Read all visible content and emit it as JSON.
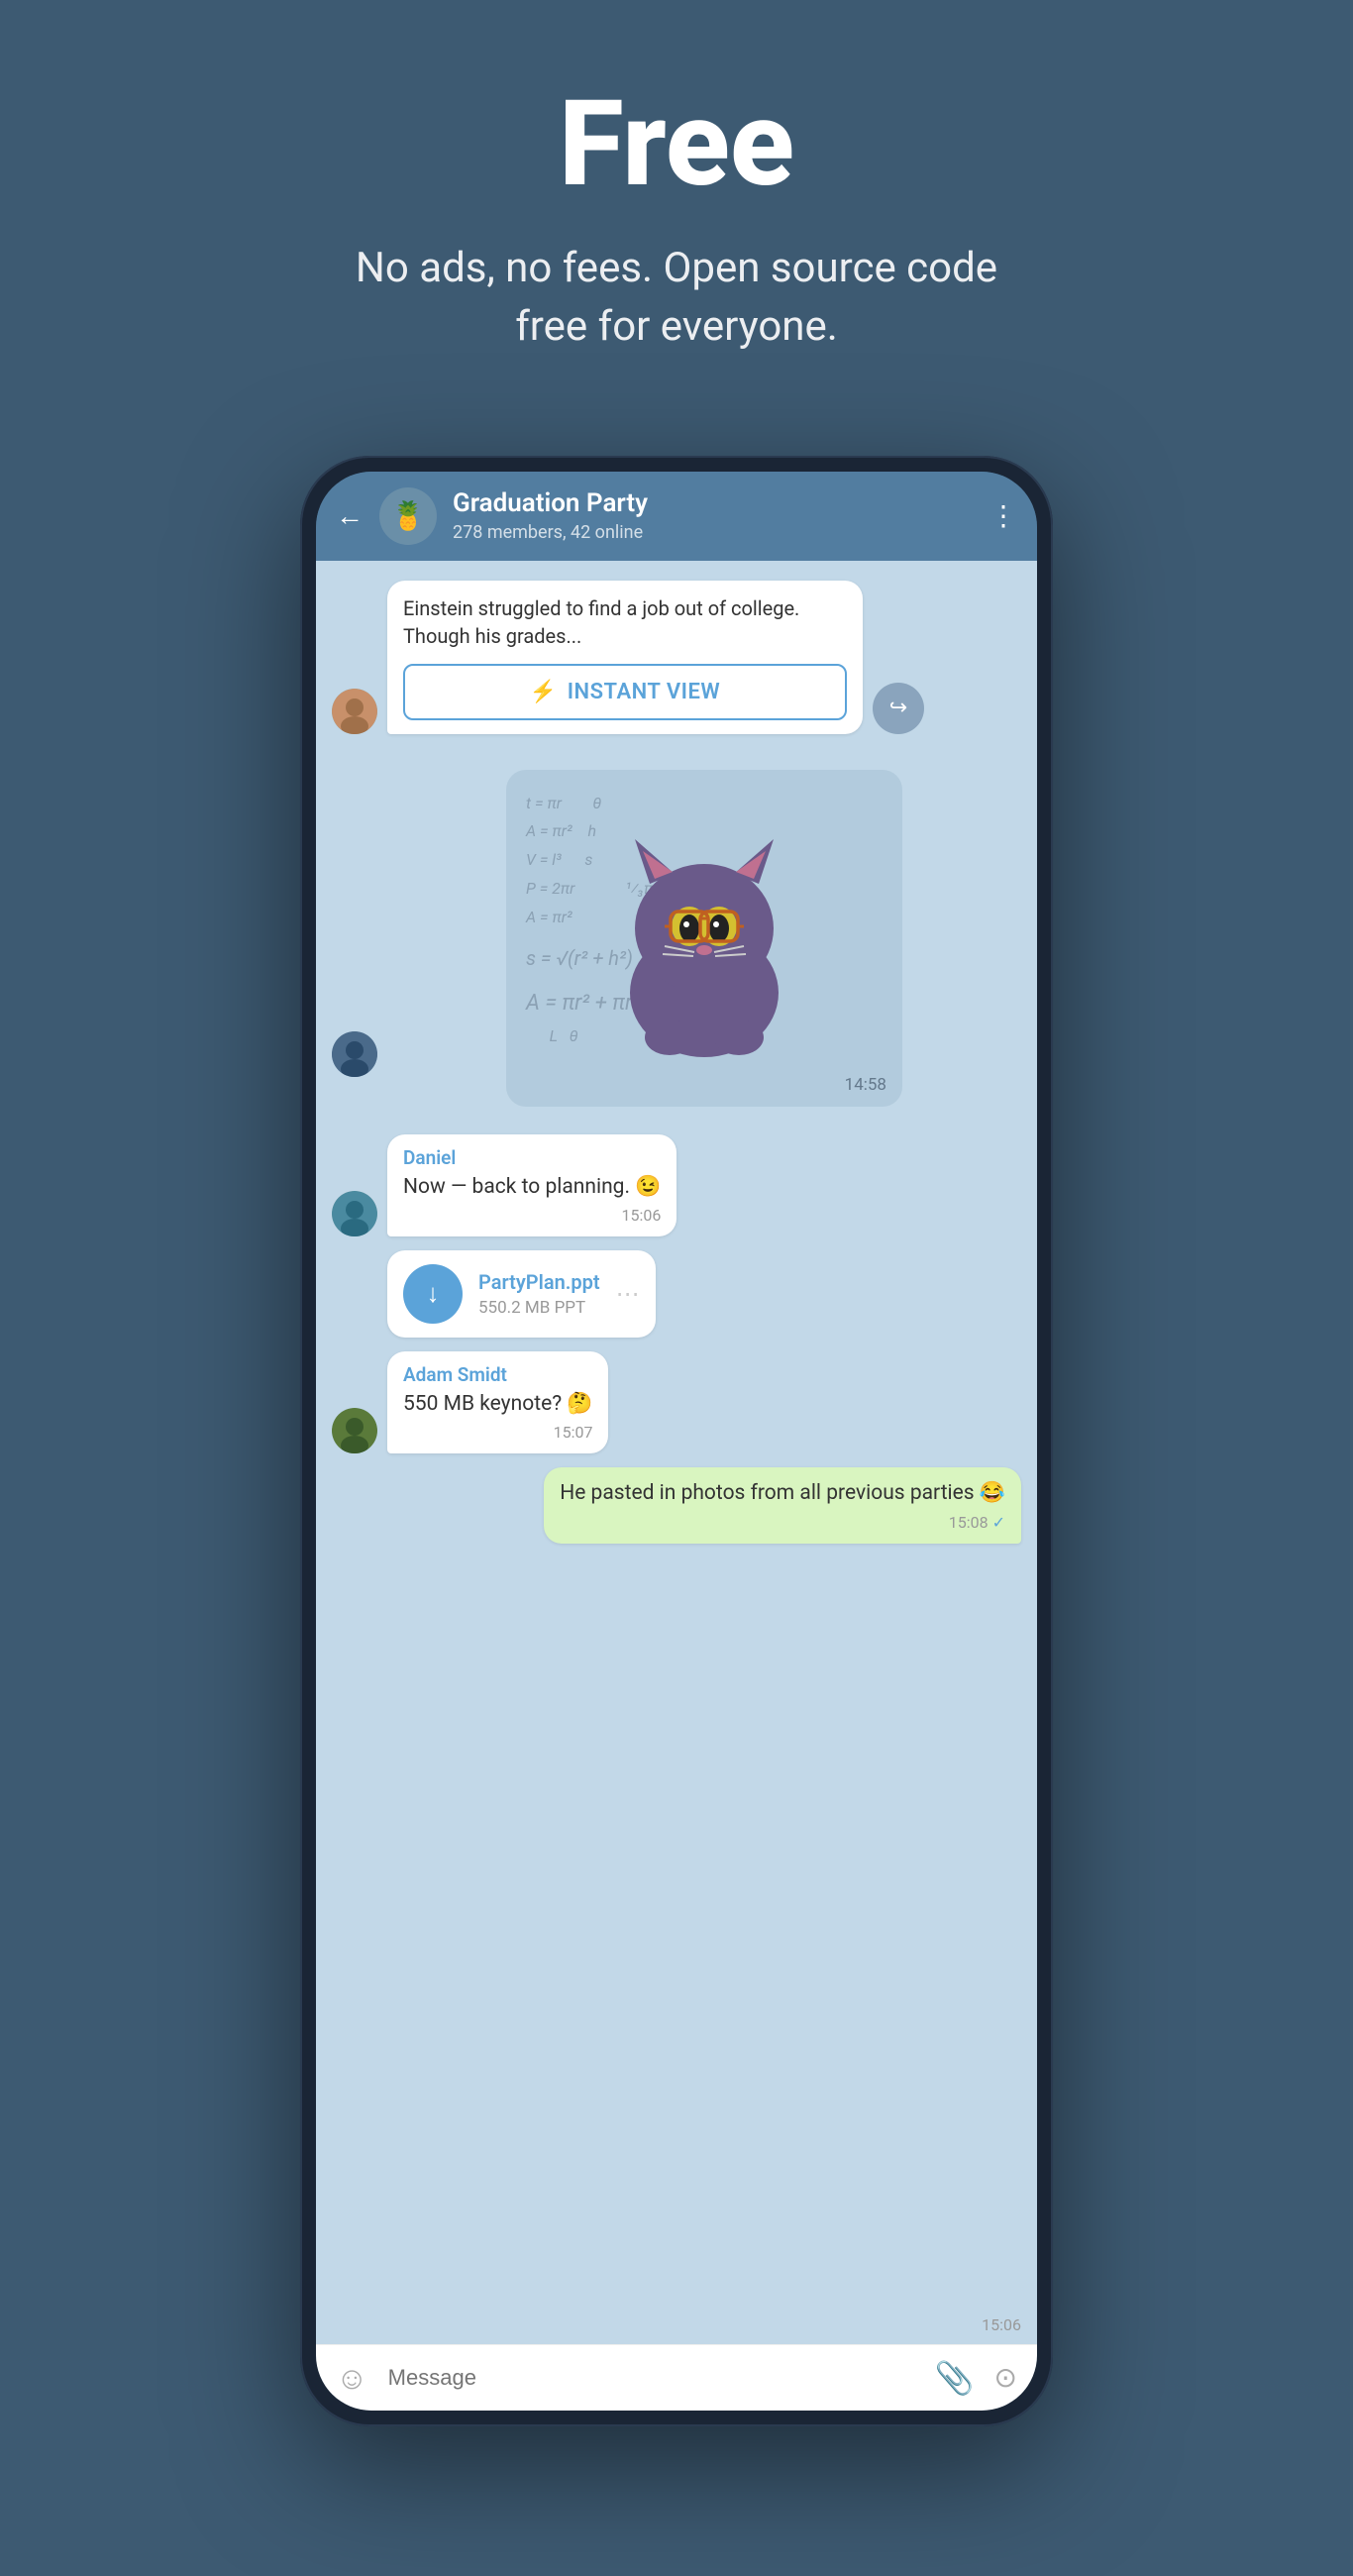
{
  "hero": {
    "title": "Free",
    "subtitle": "No ads, no fees. Open source code free for everyone."
  },
  "header": {
    "back_label": "←",
    "chat_name": "Graduation Party",
    "chat_meta": "278 members, 42 online",
    "more_icon": "⋮"
  },
  "messages": {
    "article": {
      "text": "Einstein struggled to find a job out of college. Though his grades...",
      "instant_view_label": "INSTANT VIEW"
    },
    "sticker_time": "14:58",
    "daniel": {
      "name": "Daniel",
      "text": "Now — back to planning. 😉",
      "time": "15:06"
    },
    "file": {
      "name": "PartyPlan.ppt",
      "size": "550.2 MB PPT",
      "time": "15:06"
    },
    "adam": {
      "name": "Adam Smidt",
      "text": "550 MB keynote? 🤔",
      "time": "15:07"
    },
    "outgoing": {
      "text": "He pasted in photos from all previous parties 😂",
      "time": "15:08"
    }
  },
  "input_bar": {
    "placeholder": "Message"
  },
  "math_lines": [
    "A = πr²",
    "V = l³",
    "P = 2πr",
    "A = πr²",
    "s = √(r² + h²)",
    "A = πr² + πrs",
    "t = πr",
    "L = θ"
  ]
}
